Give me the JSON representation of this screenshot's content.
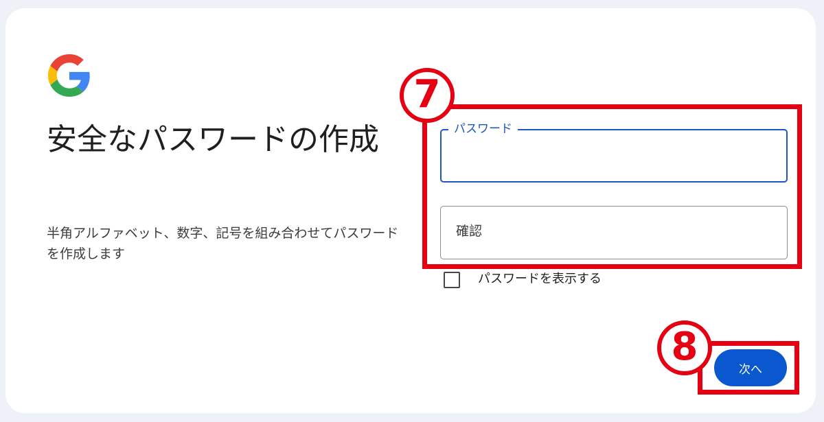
{
  "colors": {
    "accent": "#0b57d0",
    "annotation": "#e50012",
    "page_background": "#eef1f7",
    "card_background": "#ffffff"
  },
  "header": {
    "logo_icon": "google-g-icon"
  },
  "left": {
    "title": "安全なパスワードの作成",
    "description": "半角アルファベット、数字、記号を組み合わせてパスワードを作成します"
  },
  "form": {
    "password_label": "パスワード",
    "password_value": "",
    "confirm_placeholder": "確認",
    "confirm_value": "",
    "show_password_label": "パスワードを表示する",
    "show_password_checked": false,
    "next_button_label": "次へ"
  },
  "annotations": {
    "step7": "7",
    "step8": "8"
  }
}
